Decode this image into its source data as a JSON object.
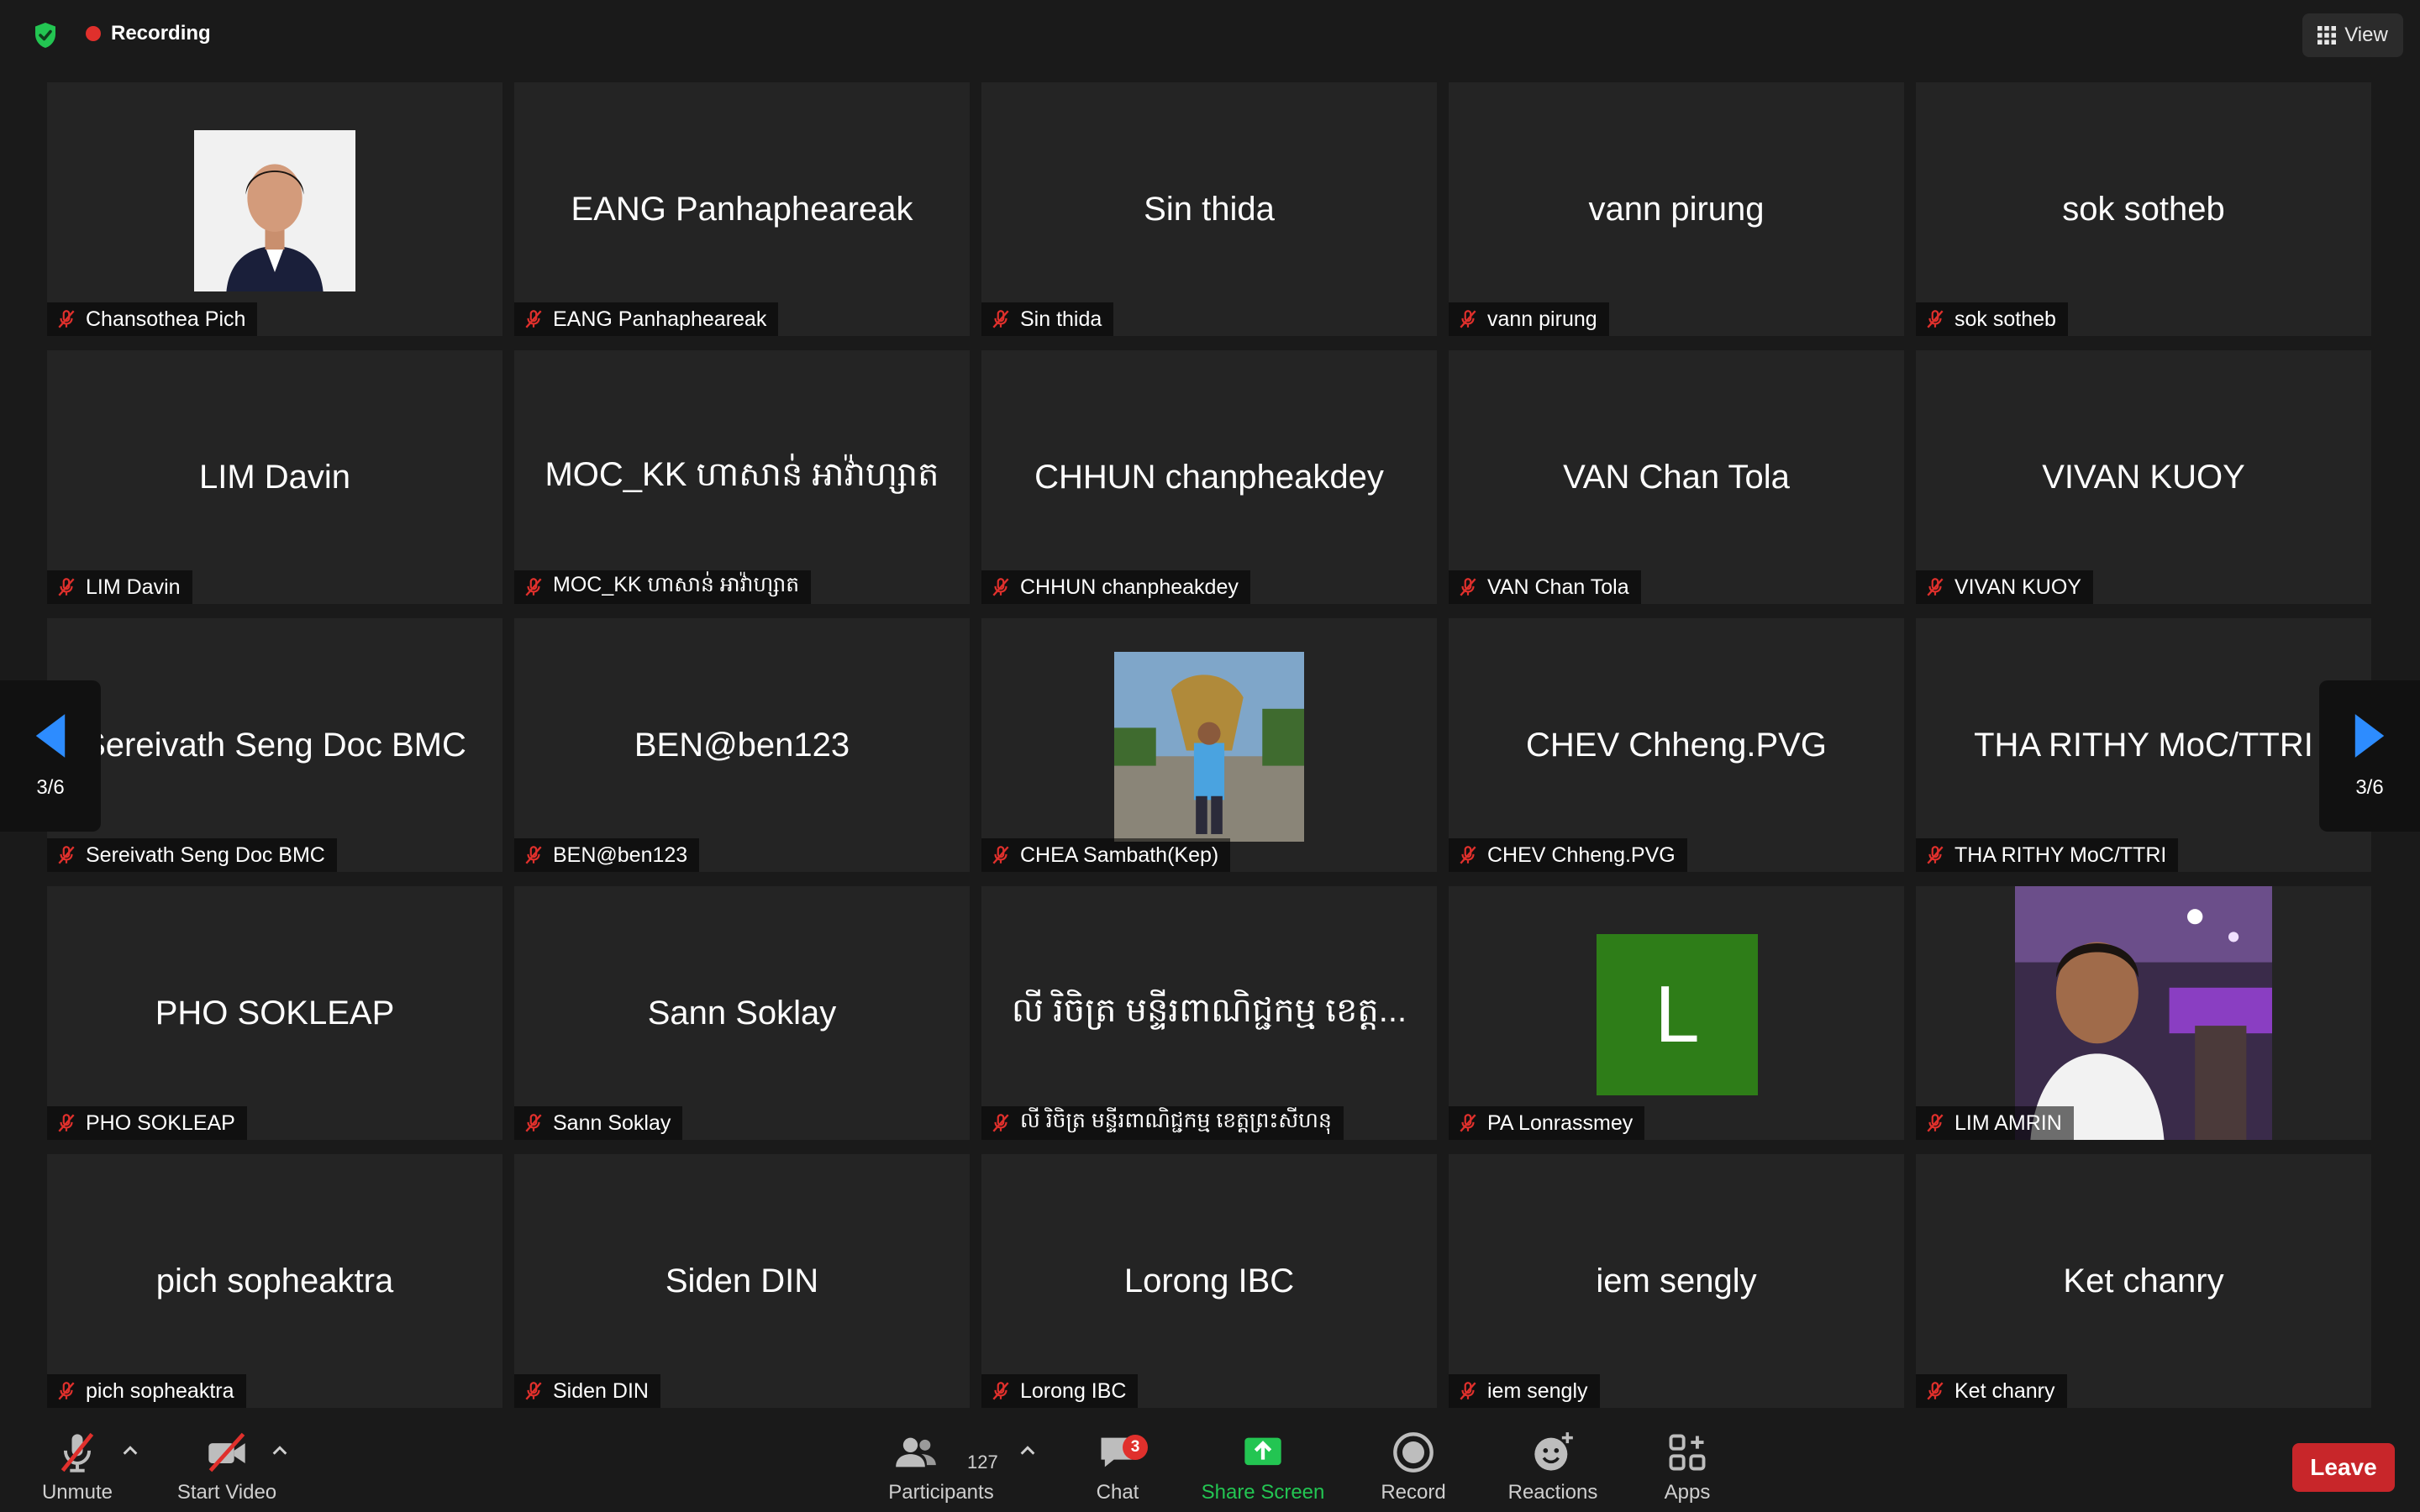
{
  "header": {
    "recording_label": "Recording",
    "view_label": "View"
  },
  "pagination": {
    "current": "3/6"
  },
  "tiles": [
    {
      "display": "",
      "label": "Chansothea Pich"
    },
    {
      "display": "EANG Panhapheareak",
      "label": "EANG Panhapheareak"
    },
    {
      "display": "Sin thida",
      "label": "Sin thida"
    },
    {
      "display": "vann pirung",
      "label": "vann pirung"
    },
    {
      "display": "sok sotheb",
      "label": "sok sotheb"
    },
    {
      "display": "LIM Davin",
      "label": "LIM Davin"
    },
    {
      "display": "MOC_KK ហាសាន់ អាវ៉ាហ្សាត",
      "label": "MOC_KK ហាសាន់ អាវ៉ាហ្សាត"
    },
    {
      "display": "CHHUN chanpheakdey",
      "label": "CHHUN chanpheakdey"
    },
    {
      "display": "VAN Chan Tola",
      "label": "VAN Chan Tola"
    },
    {
      "display": "VIVAN KUOY",
      "label": "VIVAN KUOY"
    },
    {
      "display": "Sereivath Seng Doc BMC",
      "label": "Sereivath Seng Doc BMC"
    },
    {
      "display": "BEN@ben123",
      "label": "BEN@ben123"
    },
    {
      "display": "",
      "label": "CHEA Sambath(Kep)"
    },
    {
      "display": "CHEV Chheng.PVG",
      "label": "CHEV Chheng.PVG"
    },
    {
      "display": "THA RITHY MoC/TTRI",
      "label": "THA RITHY MoC/TTRI"
    },
    {
      "display": "PHO SOKLEAP",
      "label": "PHO SOKLEAP"
    },
    {
      "display": "Sann Soklay",
      "label": "Sann Soklay"
    },
    {
      "display": "លី រិចិត្រ មន្ទីរពាណិជ្ជកម្ម ខេត្ត...",
      "label": "លី រិចិត្រ មន្ទីរពាណិជ្ជកម្ម ខេត្តព្រះសីហនុ"
    },
    {
      "display": "L",
      "label": "PA Lonrassmey"
    },
    {
      "display": "",
      "label": "LIM AMRIN"
    },
    {
      "display": "pich sopheaktra",
      "label": "pich sopheaktra"
    },
    {
      "display": "Siden DIN",
      "label": "Siden DIN"
    },
    {
      "display": "Lorong IBC",
      "label": "Lorong IBC"
    },
    {
      "display": "iem sengly",
      "label": "iem sengly"
    },
    {
      "display": "Ket chanry",
      "label": "Ket chanry"
    }
  ],
  "toolbar": {
    "unmute": "Unmute",
    "start_video": "Start Video",
    "participants": "Participants",
    "participants_count": "127",
    "chat": "Chat",
    "chat_badge": "3",
    "share_screen": "Share Screen",
    "record": "Record",
    "reactions": "Reactions",
    "apps": "Apps",
    "leave": "Leave"
  },
  "colors": {
    "accent_green": "#23c552",
    "leave_red": "#c8262a",
    "avatar_green": "#2e7d18",
    "arrow_blue": "#2d8cff"
  }
}
